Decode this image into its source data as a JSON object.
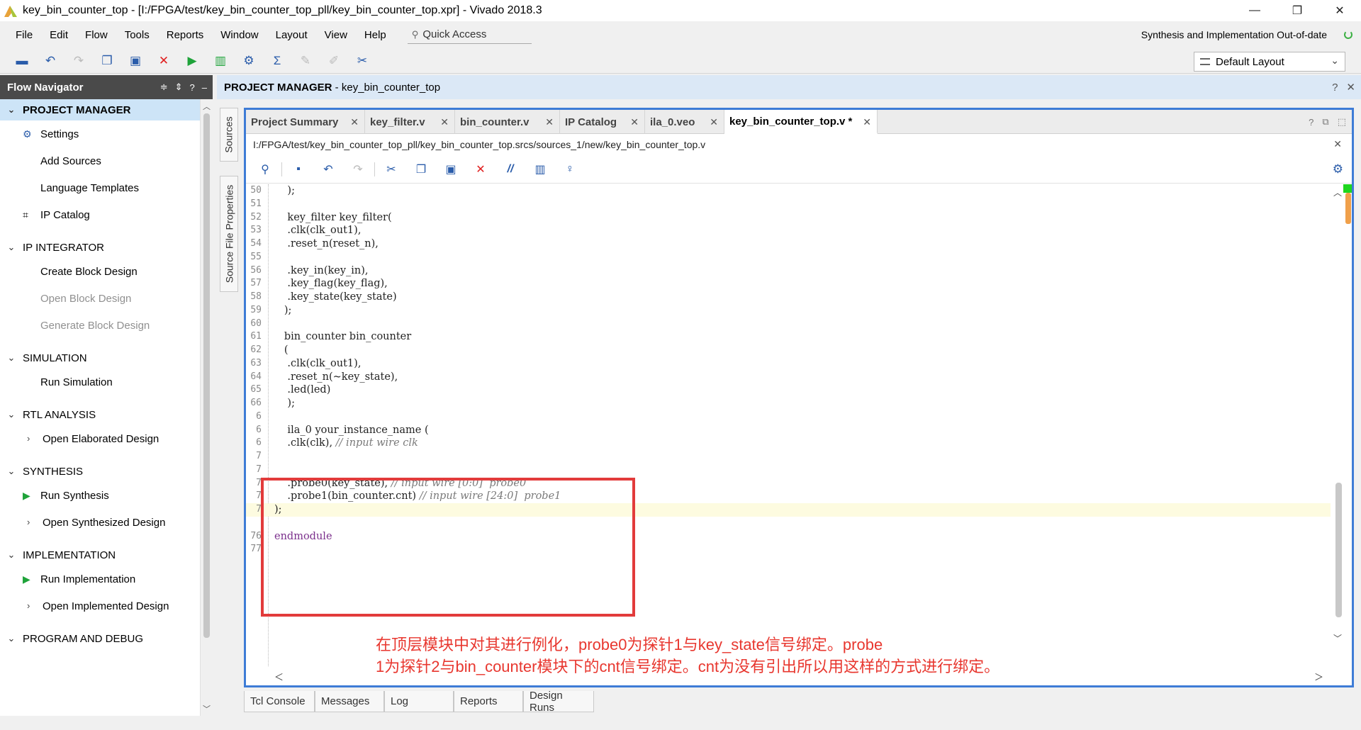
{
  "window": {
    "title": "key_bin_counter_top - [I:/FPGA/test/key_bin_counter_top_pll/key_bin_counter_top.xpr] - Vivado 2018.3",
    "minimize": "—",
    "restore": "❐",
    "close": "✕"
  },
  "menu": {
    "items": [
      {
        "label": "File"
      },
      {
        "label": "Edit"
      },
      {
        "label": "Flow"
      },
      {
        "label": "Tools"
      },
      {
        "label": "Reports"
      },
      {
        "label": "Window"
      },
      {
        "label": "Layout"
      },
      {
        "label": "View"
      },
      {
        "label": "Help"
      }
    ],
    "quick_access": "Quick Access",
    "status": "Synthesis and Implementation Out-of-date"
  },
  "toolbar": {
    "layout_select": "Default Layout"
  },
  "flow_navigator": {
    "title": "Flow Navigator",
    "header_icons": [
      "≑",
      "⇕",
      "?",
      "–"
    ],
    "sections": [
      {
        "label": "PROJECT MANAGER",
        "items": [
          {
            "label": "Settings",
            "icon": "gear-icon",
            "glyph": "⚙"
          },
          {
            "label": "Add Sources"
          },
          {
            "label": "Language Templates"
          },
          {
            "label": "IP Catalog",
            "icon": "ip-catalog-icon",
            "glyph": "⌗"
          }
        ]
      },
      {
        "label": "IP INTEGRATOR",
        "items": [
          {
            "label": "Create Block Design"
          },
          {
            "label": "Open Block Design"
          },
          {
            "label": "Generate Block Design"
          }
        ]
      },
      {
        "label": "SIMULATION",
        "items": [
          {
            "label": "Run Simulation"
          }
        ]
      },
      {
        "label": "RTL ANALYSIS",
        "items": [
          {
            "label": "Open Elaborated Design"
          }
        ]
      },
      {
        "label": "SYNTHESIS",
        "items": [
          {
            "label": "Run Synthesis",
            "icon": "run-icon",
            "glyph": "▶"
          },
          {
            "label": "Open Synthesized Design"
          }
        ]
      },
      {
        "label": "IMPLEMENTATION",
        "items": [
          {
            "label": "Run Implementation",
            "icon": "run-icon",
            "glyph": "▶"
          },
          {
            "label": "Open Implemented Design"
          }
        ]
      },
      {
        "label": "PROGRAM AND DEBUG",
        "items": []
      }
    ]
  },
  "project_manager": {
    "title_bold": "PROJECT MANAGER",
    "title_rest": " - key_bin_counter_top"
  },
  "side_tabs": [
    "Sources",
    "Source File Properties"
  ],
  "editor": {
    "tabs": [
      {
        "label": "Project Summary"
      },
      {
        "label": "key_filter.v"
      },
      {
        "label": "bin_counter.v"
      },
      {
        "label": "IP Catalog"
      },
      {
        "label": "ila_0.veo"
      },
      {
        "label": "key_bin_counter_top.v *",
        "active": true
      }
    ],
    "path": "I:/FPGA/test/key_bin_counter_top_pll/key_bin_counter_top.srcs/sources_1/new/key_bin_counter_top.v",
    "lines": [
      {
        "n": "50",
        "code": "    );"
      },
      {
        "n": "51",
        "code": ""
      },
      {
        "n": "52",
        "code": "    key_filter key_filter("
      },
      {
        "n": "53",
        "code": "    .clk(clk_out1),"
      },
      {
        "n": "54",
        "code": "    .reset_n(reset_n),"
      },
      {
        "n": "55",
        "code": ""
      },
      {
        "n": "56",
        "code": "    .key_in(key_in),"
      },
      {
        "n": "57",
        "code": "    .key_flag(key_flag),"
      },
      {
        "n": "58",
        "code": "    .key_state(key_state)"
      },
      {
        "n": "59",
        "code": "   );"
      },
      {
        "n": "60",
        "code": ""
      },
      {
        "n": "61",
        "code": "   bin_counter bin_counter"
      },
      {
        "n": "62",
        "code": "   ("
      },
      {
        "n": "63",
        "code": "    .clk(clk_out1),"
      },
      {
        "n": "64",
        "code": "    .reset_n(~key_state),"
      },
      {
        "n": "65",
        "code": "    .led(led)"
      },
      {
        "n": "66",
        "code": "    );"
      },
      {
        "n": "6",
        "code": ""
      },
      {
        "n": "6",
        "code": "    ila_0 your_instance_name ("
      },
      {
        "n": "6",
        "code": "    .clk(clk), ",
        "comment": "// input wire clk"
      },
      {
        "n": "7",
        "code": ""
      },
      {
        "n": "7",
        "code": ""
      },
      {
        "n": "7",
        "code": "    .probe0(key_state), ",
        "comment": "// input wire [0:0]  probe0"
      },
      {
        "n": "7",
        "code": "    .probe1(bin_counter.cnt) ",
        "comment": "// input wire [24:0]  probe1"
      },
      {
        "n": "7",
        "code": ");",
        "highlight": true
      },
      {
        "n": "",
        "code": ""
      },
      {
        "n": "76",
        "code": "endmodule",
        "keyword": true
      },
      {
        "n": "77",
        "code": ""
      }
    ]
  },
  "annotation": {
    "line1": "在顶层模块中对其进行例化，probe0为探针1与key_state信号绑定。probe",
    "line2": "1为探针2与bin_counter模块下的cnt信号绑定。cnt为没有引出所以用这样的方式进行绑定。"
  },
  "bottom_tabs": [
    "Tcl Console",
    "Messages",
    "Log",
    "Reports",
    "Design Runs"
  ],
  "colors": {
    "accent": "#3e7cd6",
    "annotation": "#e23b3b",
    "nav_active": "#cde4f7",
    "run_green": "#1fa33a"
  }
}
